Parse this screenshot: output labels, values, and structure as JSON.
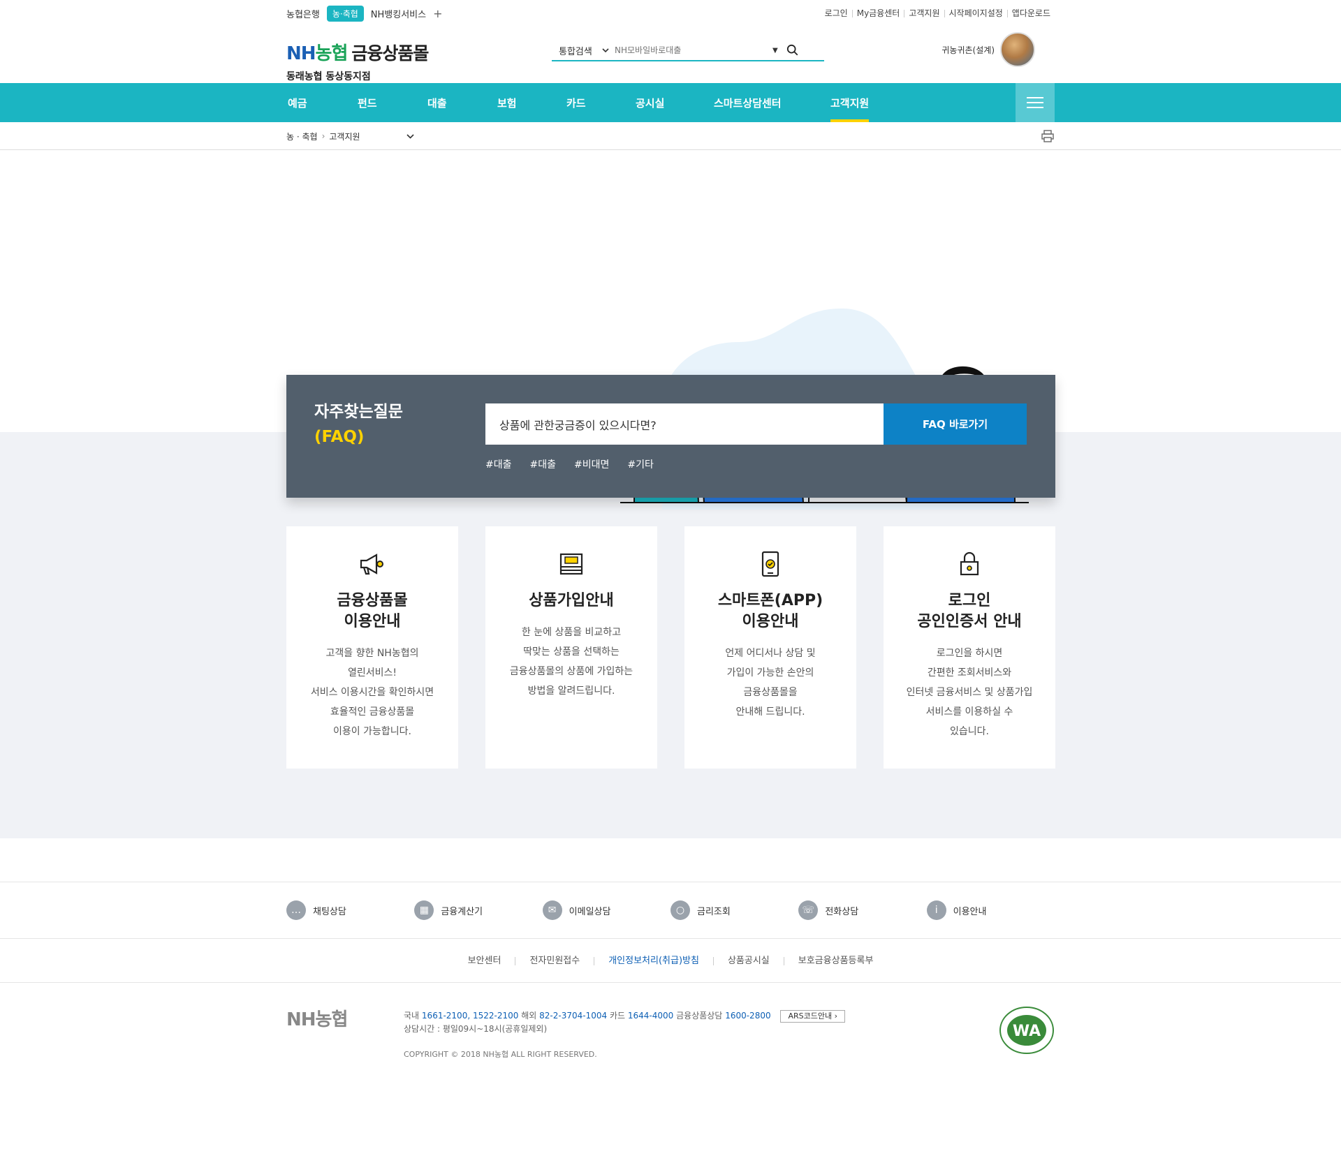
{
  "util": {
    "bank": "농협은행",
    "pill": "농·축협",
    "banking": "NH뱅킹서비스",
    "plus": "+",
    "links": [
      "로그인",
      "My금융센터",
      "고객지원",
      "시작페이지설정",
      "앱다운로드"
    ]
  },
  "header": {
    "logo_nh": "NH",
    "logo_green": "농협",
    "logo_mall": "금융상품몰",
    "branch": "동래농협 동상동지점",
    "search_select": "통합검색",
    "search_placeholder": "NH모바일바로대출",
    "user_label": "귀농귀촌(설계)"
  },
  "gnb": [
    "예금",
    "펀드",
    "대출",
    "보험",
    "카드",
    "공시실",
    "스마트상담센터",
    "고객지원"
  ],
  "breadcrumb": {
    "home": "농 · 축협",
    "current": "고객지원"
  },
  "faq": {
    "title": "자주찾는질문",
    "subtitle": "(FAQ)",
    "input": "상품에 관한궁금증이 있으시다면?",
    "button": "FAQ 바로가기",
    "tags": [
      "#대출",
      "#대출",
      "#비대면",
      "#기타"
    ]
  },
  "cards": [
    {
      "title": "금융상품몰\n이용안내",
      "desc": "고객을 향한 NH농협의\n열린서비스!\n서비스 이용시간을 확인하시면\n효율적인 금융상품몰\n이용이 가능합니다.",
      "icon": "megaphone-icon"
    },
    {
      "title": "상품가입안내",
      "desc": "한 눈에 상품을 비교하고\n딱맞는 상품을 선택하는\n금융상품몰의 상품에 가입하는\n방법을 알려드립니다.",
      "icon": "passbook-icon"
    },
    {
      "title": "스마트폰(APP)\n이용안내",
      "desc": "언제 어디서나 상담 및\n가입이 가능한 손안의\n금융상품몰을\n안내해 드립니다.",
      "icon": "smartphone-icon"
    },
    {
      "title": "로그인\n공인인증서 안내",
      "desc": "로그인을 하시면\n간편한 조회서비스와\n인터넷 금융서비스 및 상품가입\n서비스를 이용하실 수\n있습니다.",
      "icon": "lock-icon"
    }
  ],
  "footer": {
    "quick": [
      "채팅상담",
      "금융계산기",
      "이메일상담",
      "금리조회",
      "전화상담",
      "이용안내"
    ],
    "policy": [
      "보안센터",
      "전자민원접수",
      "개인정보처리(취급)방침",
      "상품공시실",
      "보호금융상품등록부"
    ],
    "logo": "NH농협",
    "domestic_label": "국내",
    "domestic": "1661-2100, 1522-2100",
    "overseas_label": "해외",
    "overseas": "82-2-3704-1004",
    "card_label": "카드",
    "card": "1644-4000",
    "product_label": "금융상품상담",
    "product": "1600-2800",
    "ars": "ARS코드안내",
    "hours": "상담시간 : 평일09시~18시(공휴일제외)",
    "copyright": "COPYRIGHT © 2018 NH농협 ALL RIGHT RESERVED.",
    "wa_badge": "WA"
  },
  "colors": {
    "teal": "#1bb5c2",
    "yellow": "#ffd200",
    "faq_bg": "#525f6c",
    "faq_btn": "#0d82c6"
  }
}
